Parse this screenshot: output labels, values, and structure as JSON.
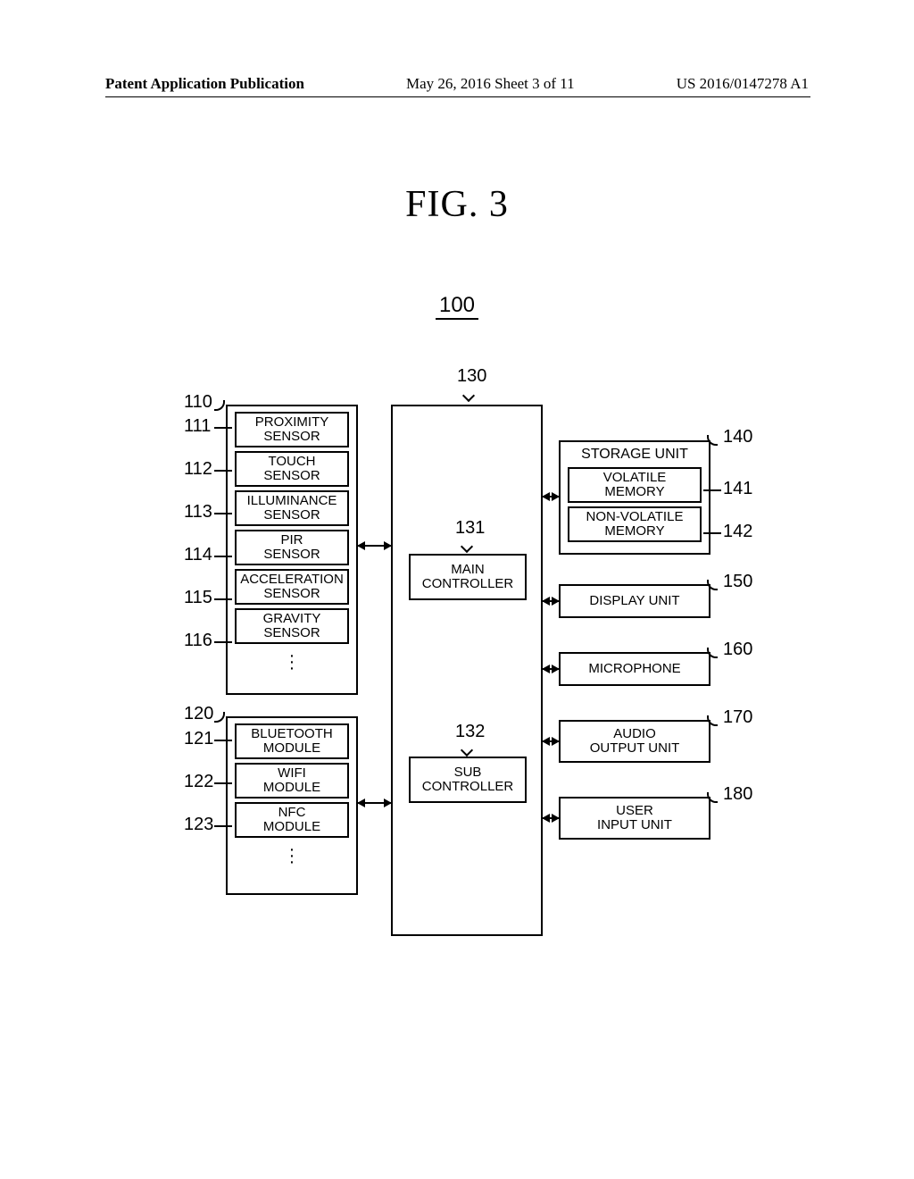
{
  "header": {
    "left": "Patent Application Publication",
    "center": "May 26, 2016  Sheet 3 of 11",
    "right": "US 2016/0147278 A1"
  },
  "figure": {
    "title": "FIG.  3",
    "system_ref": "100"
  },
  "labels": {
    "l110": "110",
    "l111": "111",
    "l112": "112",
    "l113": "113",
    "l114": "114",
    "l115": "115",
    "l116": "116",
    "l120": "120",
    "l121": "121",
    "l122": "122",
    "l123": "123",
    "l130": "130",
    "l131": "131",
    "l132": "132",
    "l140": "140",
    "l141": "141",
    "l142": "142",
    "l150": "150",
    "l160": "160",
    "l170": "170",
    "l180": "180"
  },
  "blocks": {
    "proximity": "PROXIMITY\nSENSOR",
    "touch": "TOUCH\nSENSOR",
    "illuminance": "ILLUMINANCE\nSENSOR",
    "pir": "PIR\nSENSOR",
    "acceleration": "ACCELERATION\nSENSOR",
    "gravity": "GRAVITY\nSENSOR",
    "bluetooth": "BLUETOOTH\nMODULE",
    "wifi": "WIFI\nMODULE",
    "nfc": "NFC\nMODULE",
    "main_ctrl": "MAIN\nCONTROLLER",
    "sub_ctrl": "SUB\nCONTROLLER",
    "storage": "STORAGE UNIT",
    "volatile": "VOLATILE\nMEMORY",
    "nonvolatile": "NON-VOLATILE\nMEMORY",
    "display": "DISPLAY UNIT",
    "microphone": "MICROPHONE",
    "audio": "AUDIO\nOUTPUT UNIT",
    "user_input": "USER\nINPUT UNIT"
  }
}
